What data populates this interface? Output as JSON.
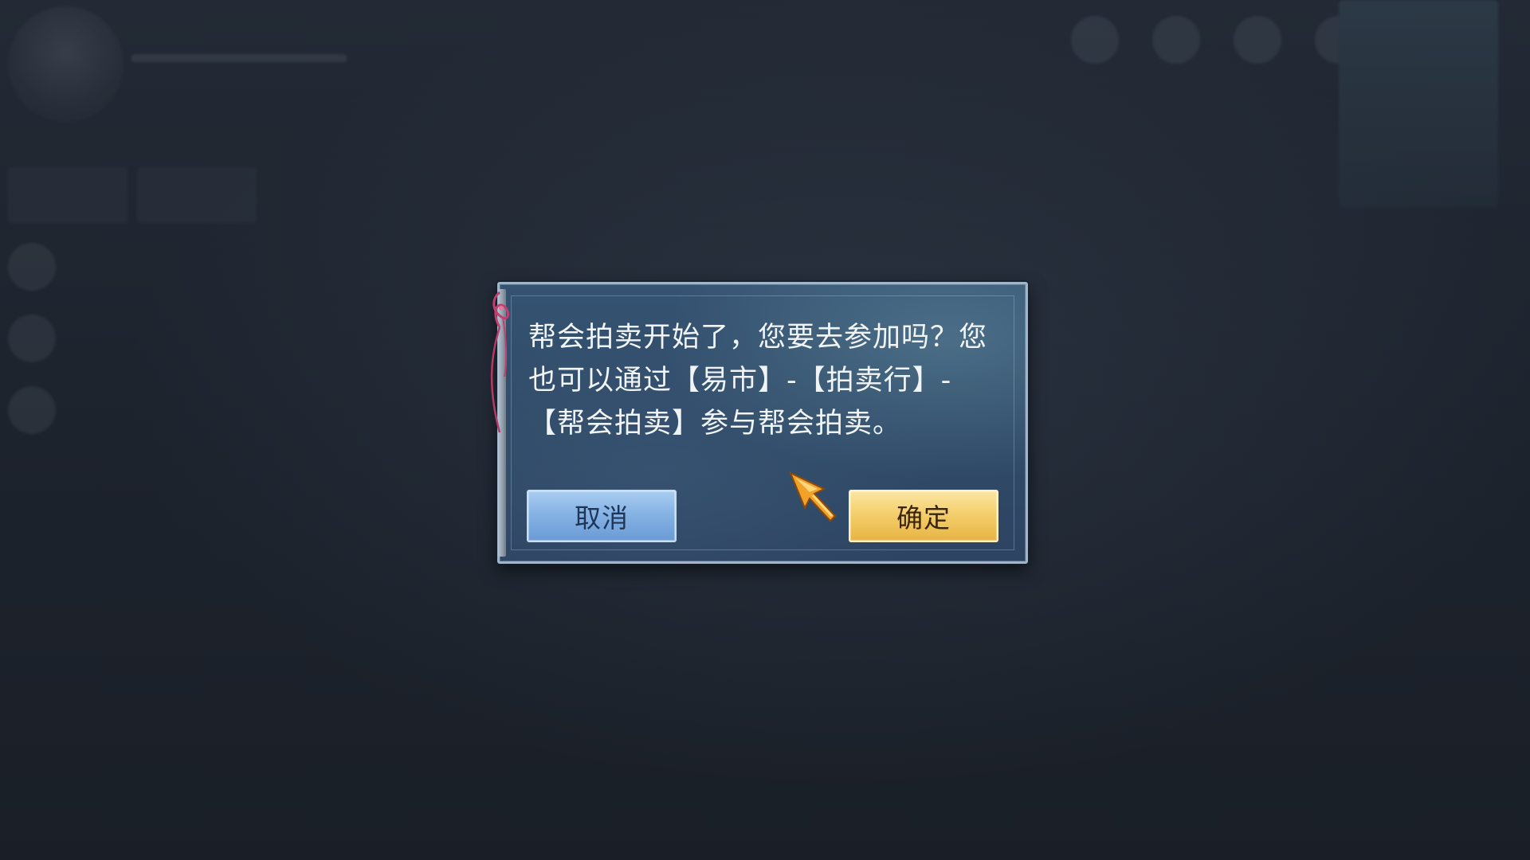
{
  "dialog": {
    "message": "帮会拍卖开始了，您要去参加吗？您也可以通过【易市】-【拍卖行】-【帮会拍卖】参与帮会拍卖。",
    "cancel_label": "取消",
    "confirm_label": "确定"
  },
  "colors": {
    "dialog_bg": "#2f4a67",
    "cancel_button": "#86b3e4",
    "confirm_button": "#f4cf6c",
    "ribbon": "#c0406f",
    "cursor": "#f2a12a"
  },
  "icons": {
    "cursor": "arrow-cursor-icon",
    "ribbon": "ribbon-icon"
  }
}
